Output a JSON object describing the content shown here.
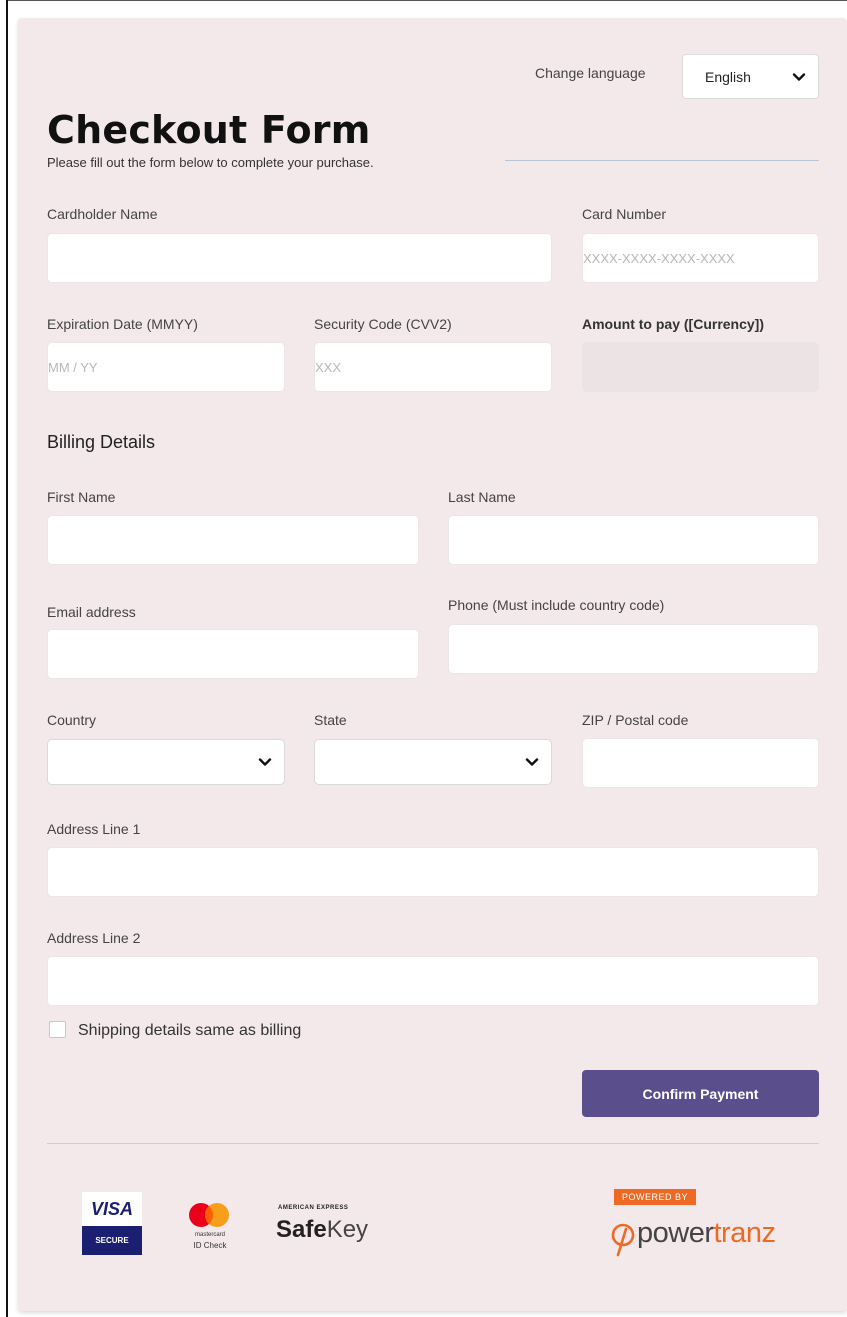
{
  "language": {
    "label": "Change language",
    "selected": "English"
  },
  "header": {
    "title": "Checkout Form",
    "subtitle": "Please fill out the form below to complete your purchase."
  },
  "payment": {
    "cardholder_name_label": "Cardholder Name",
    "card_number_label": "Card Number",
    "card_number_placeholder": "XXXX-XXXX-XXXX-XXXX",
    "expiration_label": "Expiration Date (MMYY)",
    "expiration_placeholder": "MM / YY",
    "cvv_label": "Security Code (CVV2)",
    "cvv_placeholder": "XXX",
    "amount_label": "Amount to pay ([Currency])"
  },
  "billing": {
    "section_title": "Billing Details",
    "first_name_label": "First Name",
    "last_name_label": "Last Name",
    "email_label": "Email address",
    "phone_label": "Phone (Must include country code)",
    "country_label": "Country",
    "state_label": "State",
    "zip_label": "ZIP / Postal code",
    "address1_label": "Address Line 1",
    "address2_label": "Address Line 2"
  },
  "shipping_same_label": "Shipping details same as billing",
  "confirm_button": "Confirm Payment",
  "footer": {
    "visa_brand": "VISA",
    "visa_secure": "SECURE",
    "mastercard_small": "mastercard",
    "mastercard_idcheck": "ID Check",
    "amex_top": "AMERICAN EXPRESS",
    "amex_safe": "Safe",
    "amex_key": "Key",
    "powered_by": "POWERED BY",
    "powertranz_a": "power",
    "powertranz_b": "tranz"
  },
  "colors": {
    "card_bg": "#f3e9ea",
    "button_bg": "#5a4f8c",
    "visa_blue": "#1a1f71",
    "powertranz_orange": "#ee6a24",
    "mastercard_red": "#eb001b",
    "mastercard_orange": "#f79e1b"
  }
}
